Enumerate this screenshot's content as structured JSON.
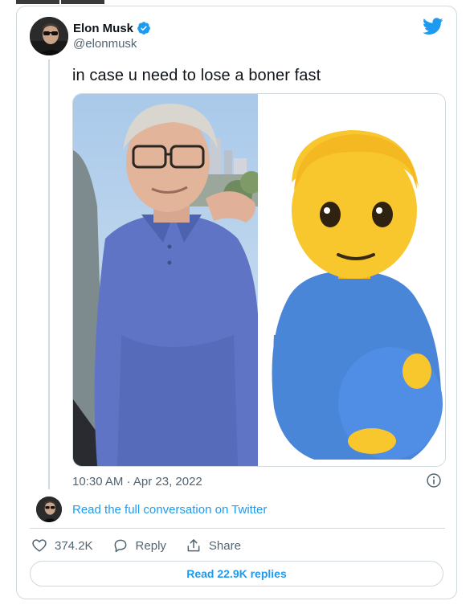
{
  "author": {
    "name": "Elon Musk",
    "handle": "@elonmusk",
    "verified": true
  },
  "tweet": {
    "text": "in case u need to lose a boner fast",
    "timestamp": "10:30 AM · Apr 23, 2022",
    "media": {
      "left_image": "photo-man-blue-polo",
      "right_image": "pregnant-man-emoji"
    }
  },
  "conversation": {
    "read_full_label": "Read the full conversation on Twitter"
  },
  "actions": {
    "like_count": "374.2K",
    "reply_label": "Reply",
    "share_label": "Share"
  },
  "replies_button": {
    "label": "Read 22.9K replies"
  },
  "colors": {
    "accent": "#1d9bf0",
    "text_primary": "#0f1419",
    "text_secondary": "#536471",
    "border": "#cfd9de"
  },
  "icons": [
    "verified-badge-icon",
    "twitter-bird-icon",
    "info-icon",
    "heart-icon",
    "reply-icon",
    "share-icon"
  ]
}
